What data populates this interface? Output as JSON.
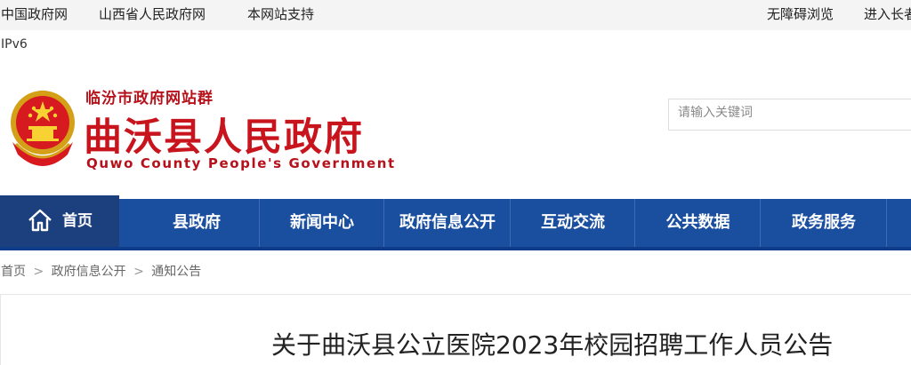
{
  "topbar": {
    "links": [
      "中国政府网",
      "山西省人民政府网",
      "本网站支持"
    ],
    "right_links": [
      "无障碍浏览",
      "进入长者"
    ]
  },
  "ipv6_label": "IPv6",
  "header": {
    "site_group": "临汾市政府网站群",
    "site_name": "曲沃县人民政府",
    "site_name_en": "Quwo County People's Government",
    "search_placeholder": "请输入关键词"
  },
  "nav": {
    "home": "首页",
    "items": [
      "县政府",
      "新闻中心",
      "政府信息公开",
      "互动交流",
      "公共数据",
      "政务服务"
    ]
  },
  "breadcrumb": [
    "首页",
    "政府信息公开",
    "通知公告"
  ],
  "breadcrumb_sep": ">",
  "article": {
    "title": "关于曲沃县公立医院2023年校园招聘工作人员公告"
  },
  "colors": {
    "nav_blue": "#1a4fa0",
    "nav_home_dark": "#1c3f7e",
    "brand_red": "#c8151d"
  }
}
